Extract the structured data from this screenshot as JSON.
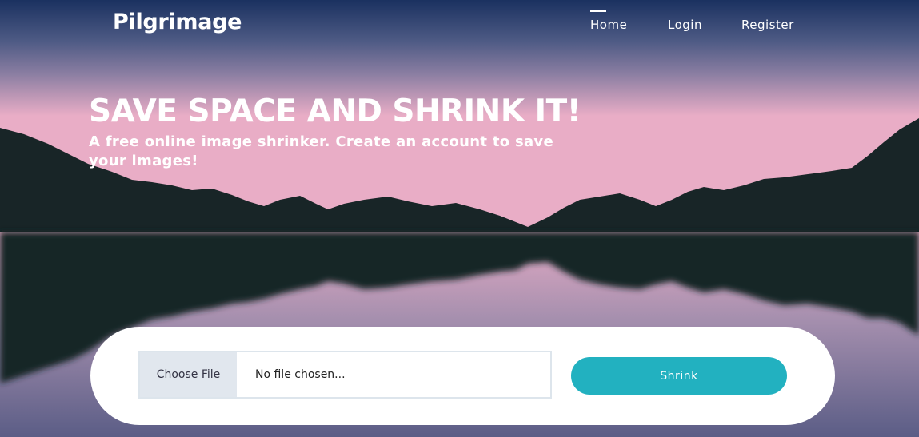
{
  "brand": "Pilgrimage",
  "nav": {
    "home": "Home",
    "login": "Login",
    "register": "Register"
  },
  "hero": {
    "title": "SAVE SPACE AND SHRINK IT!",
    "subtitle": "A free online image shrinker. Create an account to save your images!"
  },
  "upload": {
    "choose_label": "Choose File",
    "file_status": "No file chosen...",
    "submit_label": "Shrink"
  },
  "colors": {
    "accent": "#22b1c0",
    "sky_top": "#1a3160",
    "sky_horizon": "#e9adc6",
    "mountain": "#182527"
  }
}
